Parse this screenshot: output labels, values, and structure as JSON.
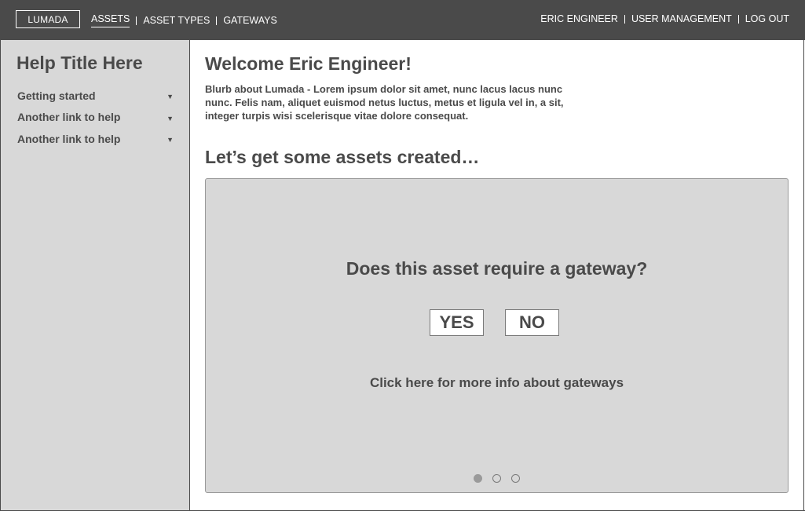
{
  "topnav": {
    "logo": "LUMADA",
    "left_links": [
      "ASSETS",
      "ASSET TYPES",
      "GATEWAYS"
    ],
    "active_link": "ASSETS",
    "right_links": [
      "ERIC ENGINEER",
      "USER MANAGEMENT",
      "LOG OUT"
    ]
  },
  "sidebar": {
    "title": "Help Title Here",
    "items": [
      {
        "label": "Getting started",
        "icon": "caret-down-icon"
      },
      {
        "label": "Another link to help",
        "icon": "caret-down-icon"
      },
      {
        "label": "Another link to help",
        "icon": "caret-down-icon"
      }
    ]
  },
  "main": {
    "welcome": "Welcome Eric Engineer!",
    "blurb": "Blurb about Lumada - Lorem ipsum dolor sit amet, nunc lacus lacus nunc nunc. Felis nam, aliquet euismod netus luctus, metus et ligula vel in, a sit, integer turpis wisi scelerisque vitae dolore consequat.",
    "section_title": "Let’s get some assets created…",
    "card": {
      "question": "Does this asset require a gateway?",
      "yes_label": "YES",
      "no_label": "NO",
      "more_info": "Click here for more info about gateways",
      "pager": {
        "total": 3,
        "active_index": 0
      }
    }
  },
  "colors": {
    "header_bg": "#4a4a4a",
    "panel_bg": "#d8d8d8",
    "text": "#4a4a4a"
  }
}
